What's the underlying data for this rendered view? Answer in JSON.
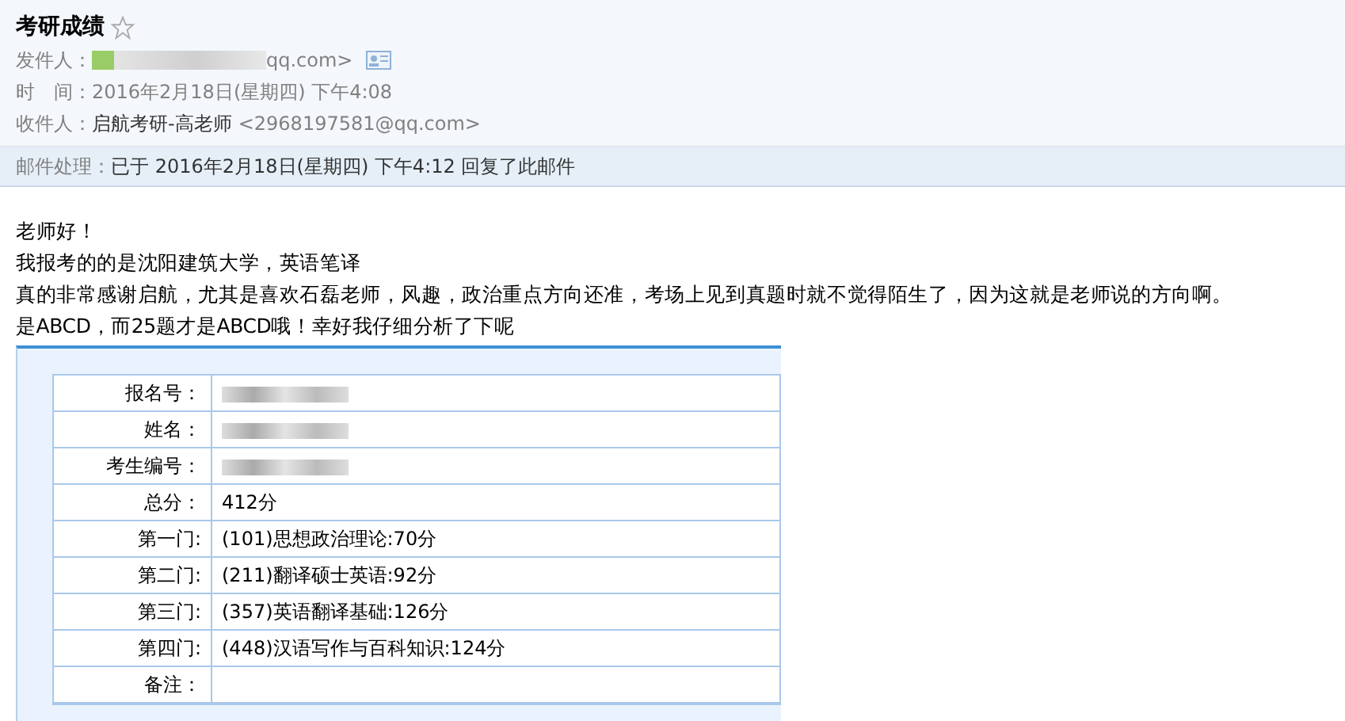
{
  "mail": {
    "subject": "考研成绩",
    "starred": false,
    "sender": {
      "label": "发件人：",
      "address_tail": "qq.com>"
    },
    "time": {
      "label": "时　间：",
      "value": "2016年2月18日(星期四) 下午4:08"
    },
    "recipient": {
      "label": "收件人：",
      "name": "启航考研-高老师",
      "address": "<2968197581@qq.com>"
    },
    "handling": {
      "label": "邮件处理：",
      "value": "已于 2016年2月18日(星期四) 下午4:12 回复了此邮件"
    }
  },
  "body": [
    "老师好！",
    "我报考的的是沈阳建筑大学，英语笔译",
    "真的非常感谢启航，尤其是喜欢石磊老师，风趣，政治重点方向还准，考场上见到真题时就不觉得陌生了，因为这就是老师说的方向啊。",
    "是ABCD，而25题才是ABCD哦！幸好我仔细分析了下呢"
  ],
  "score_table": {
    "rows": [
      {
        "label": "报名号：",
        "kind": "redacted"
      },
      {
        "label": "姓名：",
        "kind": "redacted"
      },
      {
        "label": "考生编号：",
        "kind": "redacted"
      },
      {
        "label": "总分：",
        "kind": "text",
        "value": "412分"
      },
      {
        "label": "第一门:",
        "kind": "text",
        "value": "(101)思想政治理论:70分"
      },
      {
        "label": "第二门:",
        "kind": "text",
        "value": "(211)翻译硕士英语:92分"
      },
      {
        "label": "第三门:",
        "kind": "text",
        "value": "(357)英语翻译基础:126分"
      },
      {
        "label": "第四门:",
        "kind": "text",
        "value": "(448)汉语写作与百科知识:124分"
      },
      {
        "label": "备注：",
        "kind": "empty"
      }
    ]
  }
}
